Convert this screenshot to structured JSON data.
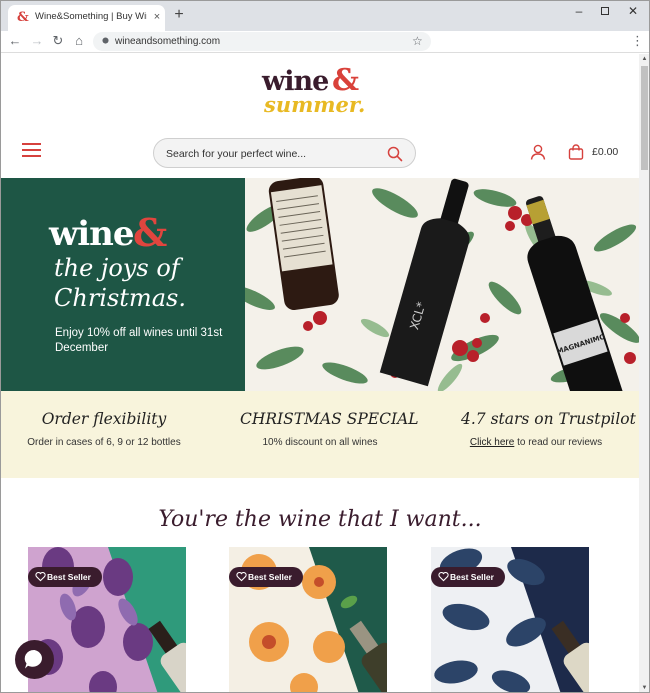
{
  "browser": {
    "tab_title": "Wine&Something | Buy Wine Online",
    "tab_favicon": "&",
    "tab_close": "×",
    "new_tab": "+",
    "url": "wineandsomething.com",
    "controls": {
      "minimize": "–",
      "close": "✕"
    },
    "nav": {
      "back": "←",
      "forward": "→",
      "reload": "↻",
      "home": "⌂"
    },
    "star": "☆",
    "menu": "⋮"
  },
  "logo": {
    "wine": "wine",
    "amp": "&",
    "summer": "summer."
  },
  "header": {
    "search_placeholder": "Search for your perfect wine...",
    "basket_total": "£0.00"
  },
  "hero": {
    "brand_wine": "wine",
    "brand_amp": "&",
    "line1": "the joys of",
    "line2": "Christmas.",
    "offer": "Enjoy 10% off all wines until 31st December",
    "bottle_label": "MAGNANIMO"
  },
  "usp": [
    {
      "title": "Order flexibility",
      "text": "Order in cases of 6, 9 or 12 bottles"
    },
    {
      "title": "CHRISTMAS SPECIAL",
      "text": "10% discount on all wines"
    },
    {
      "title": "4.7 stars on Trustpilot",
      "link": "Click here",
      "text": " to read our reviews"
    }
  ],
  "section_title": "You're the wine that I want...",
  "products": [
    {
      "badge": "Best Seller",
      "theme": "plum"
    },
    {
      "badge": "Best Seller",
      "theme": "peach"
    },
    {
      "badge": "Best Seller",
      "theme": "mussel"
    }
  ],
  "colors": {
    "brand_plum": "#3a1c2d",
    "brand_red": "#d9413a",
    "brand_yellow": "#e8b923",
    "hero_green": "#1e5645",
    "usp_cream": "#f8f4dc"
  },
  "icons": [
    "hamburger-icon",
    "search-icon",
    "account-icon",
    "basket-icon",
    "heart-icon",
    "chat-icon",
    "lock-icon"
  ]
}
